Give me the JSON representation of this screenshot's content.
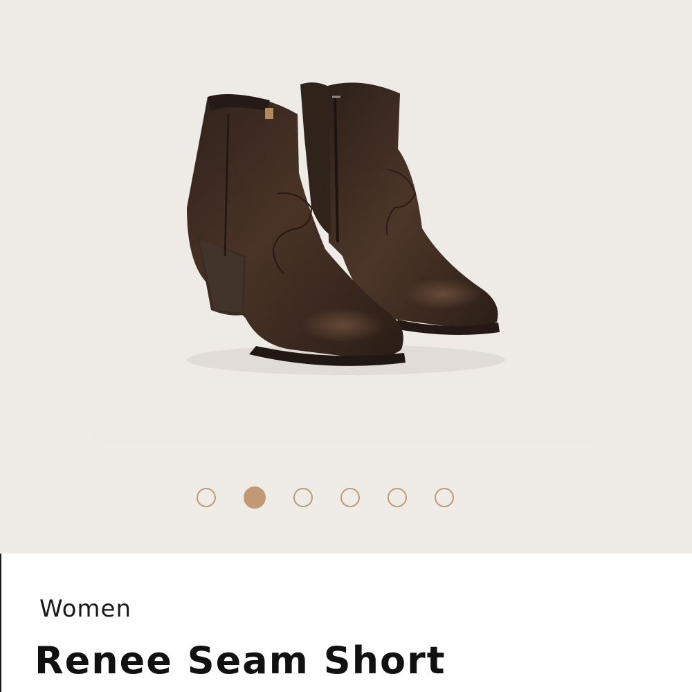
{
  "gallery": {
    "image_alt": "Dark brown leather ankle boots, pair",
    "dots": [
      {
        "label": "Image 1",
        "active": false
      },
      {
        "label": "Image 2",
        "active": true
      },
      {
        "label": "Image 3",
        "active": false
      },
      {
        "label": "Image 4",
        "active": false
      },
      {
        "label": "Image 5",
        "active": false
      },
      {
        "label": "Image 6",
        "active": false
      }
    ]
  },
  "product": {
    "category": "Women",
    "name": "Renee Seam Short"
  },
  "colors": {
    "background": "#efece7",
    "accent": "#c19a74",
    "text": "#111111",
    "boot_leather": "#3b2a22"
  }
}
